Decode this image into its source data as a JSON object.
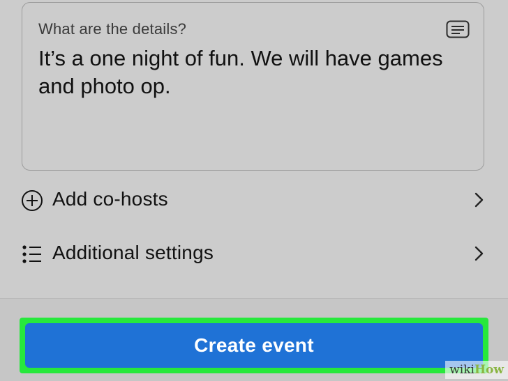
{
  "details": {
    "label": "What are the details?",
    "text": "It’s a one night of fun. We will have games and photo op.",
    "icon": "text-lines-icon"
  },
  "rows": [
    {
      "label": "Add co-hosts",
      "icon": "plus-circle-icon",
      "chevron": "chevron-right-icon"
    },
    {
      "label": "Additional settings",
      "icon": "bulleted-list-icon",
      "chevron": "chevron-right-icon"
    }
  ],
  "create_button": {
    "label": "Create event",
    "color": "#1f72d6",
    "highlight_color": "#27e83c"
  },
  "watermark": {
    "part1": "wiki",
    "part2": "How"
  }
}
